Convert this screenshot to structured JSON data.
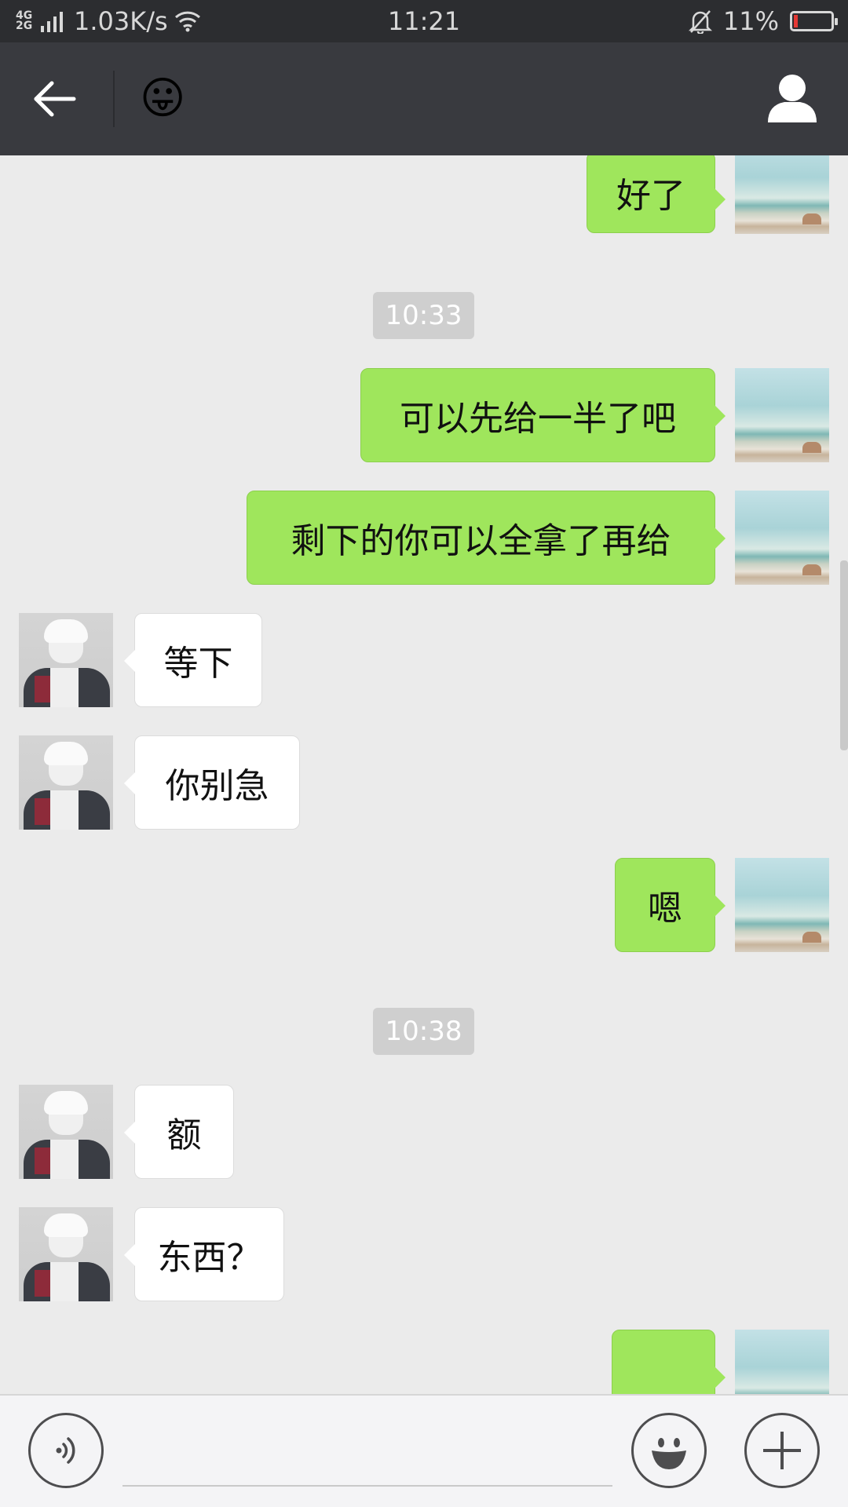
{
  "status_bar": {
    "network_label": "4G 2G",
    "speed": "1.03K/s",
    "time": "11:21",
    "battery_text": "11%",
    "battery_level": 0.11,
    "icons": [
      "signal-icon",
      "wifi-icon",
      "mute-bell-icon",
      "battery-icon"
    ]
  },
  "header": {
    "contact_emoji": "😛",
    "icons": [
      "back-arrow-icon",
      "profile-icon"
    ]
  },
  "messages": [
    {
      "side": "me",
      "text": "好了"
    },
    {
      "type": "timestamp",
      "text": "10:33"
    },
    {
      "side": "me",
      "text": "可以先给一半了吧"
    },
    {
      "side": "me",
      "text": "剩下的你可以全拿了再给"
    },
    {
      "side": "other",
      "text": "等下"
    },
    {
      "side": "other",
      "text": "你别急"
    },
    {
      "side": "me",
      "text": "嗯"
    },
    {
      "type": "timestamp",
      "text": "10:38"
    },
    {
      "side": "other",
      "text": "额"
    },
    {
      "side": "other",
      "text": "东西？"
    },
    {
      "side": "me",
      "text": "……"
    }
  ],
  "input_bar": {
    "input_value": "",
    "icons": [
      "voice-icon",
      "emoji-icon",
      "plus-icon"
    ]
  },
  "colors": {
    "status_bg": "#2c2d30",
    "title_bg": "#393a3f",
    "chat_bg": "#ebebeb",
    "my_bubble": "#9fe65c",
    "other_bubble": "#ffffff",
    "battery_low": "#e53935"
  }
}
